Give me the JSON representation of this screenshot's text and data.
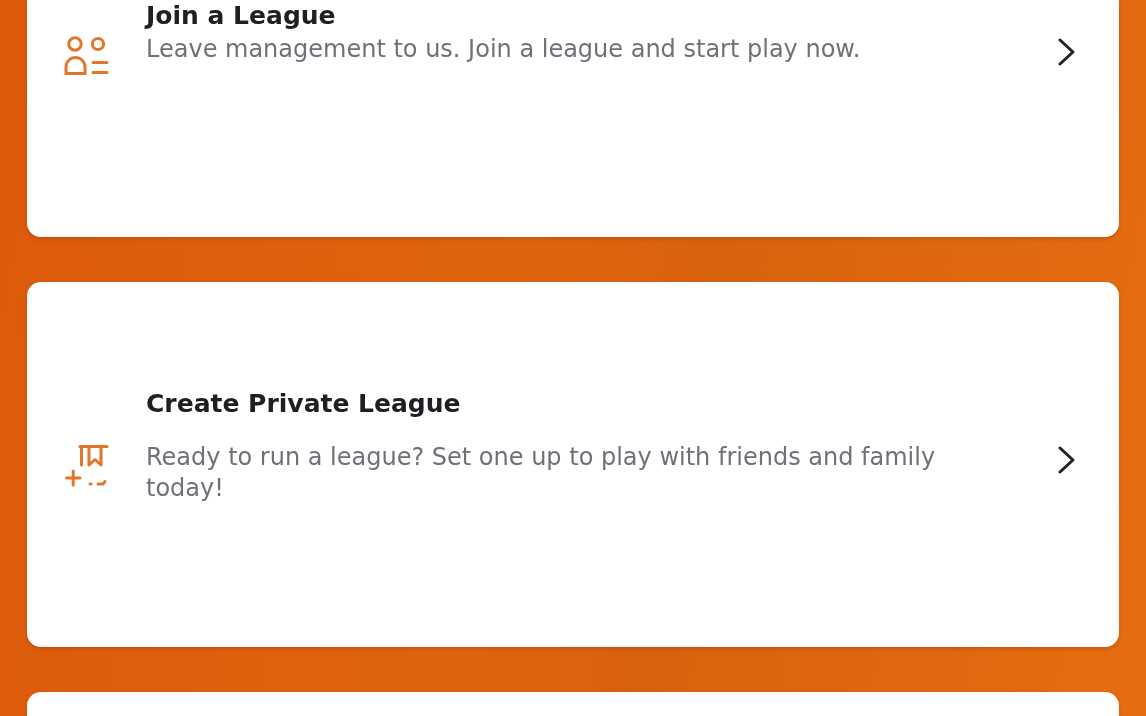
{
  "cards": [
    {
      "kind": "members",
      "title": "Join a League",
      "description": "Leave management to us. Join a league and start play now."
    },
    {
      "kind": "private",
      "title": "Create Private League",
      "description": "Ready to run a league? Set one up to play with friends and family today!"
    },
    {
      "kind": "empty"
    }
  ]
}
